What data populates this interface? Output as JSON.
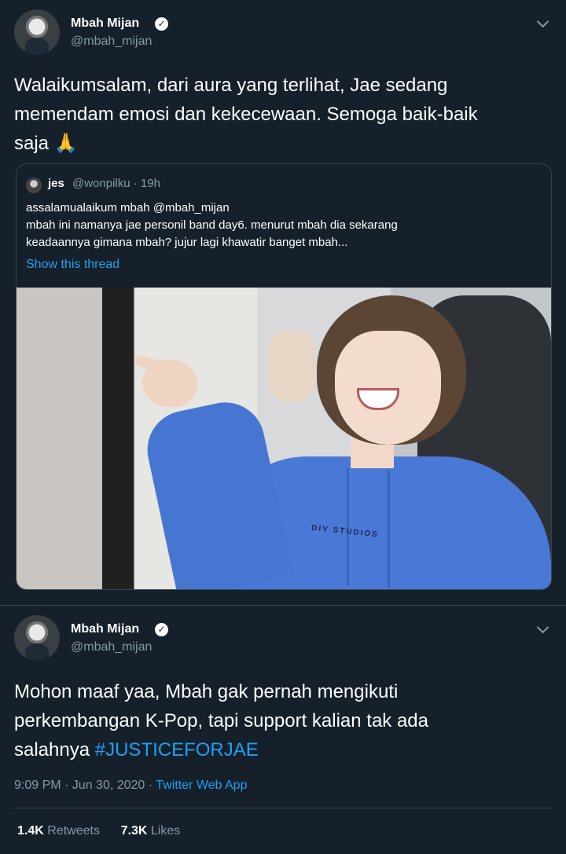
{
  "tweet1": {
    "author": {
      "name": "Mbah Mijan",
      "handle": "@mbah_mijan"
    },
    "text": "Walaikumsalam, dari aura yang terlihat, Jae sedang memendam emosi dan kekecewaan. Semoga baik-baik",
    "text_line1": "Walaikumsalam, dari aura yang terlihat, Jae sedang",
    "text_line2": "memendam emosi dan kekecewaan. Semoga baik-baik",
    "text_line3": "saja",
    "emoji": "🙏",
    "quoted": {
      "name": "jes",
      "handle": "@wonpilku",
      "time": "· 19h",
      "lines": [
        "assalamualaikum mbah @mbah_mijan",
        "mbah ini namanya jae personil band day6. menurut mbah dia sekarang",
        "keadaannya gimana mbah? jujur lagi khawatir banget mbah..."
      ],
      "link": "Show this thread",
      "photo_caption": "DIV STUDIOS"
    }
  },
  "tweet2": {
    "author": {
      "name": "Mbah Mijan",
      "handle": "@mbah_mijan"
    },
    "text_line1": "Mohon maaf yaa, Mbah gak pernah mengikuti",
    "text_line2": "perkembangan K-Pop, tapi support kalian tak ada",
    "text_line3": "salahnya",
    "hashtag": "#JUSTICEFORJAE",
    "time": "9:09 PM · Jun 30, 2020 ·",
    "source": "Twitter Web App",
    "retweets": "1.4K",
    "retweets_label": "Retweets",
    "likes": "7.3K",
    "likes_label": "Likes"
  },
  "colors": {
    "bg": "#15202b",
    "accent": "#1da1f2",
    "muted": "#8899a6",
    "border": "#38444d"
  },
  "icons": [
    "verified-badge-icon",
    "chevron-down-icon"
  ]
}
